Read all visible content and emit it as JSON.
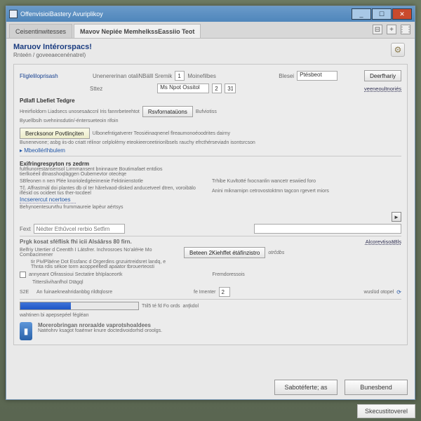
{
  "window": {
    "title": "OffenvisioiBastery Avuriplikoy"
  },
  "titlebuttons": {
    "min": "_",
    "max": "☐",
    "close": "✕"
  },
  "tabs": {
    "items": [
      {
        "label": "Ceisentinwitesses"
      },
      {
        "label": "Mavov Nepiée MemhelkssEassiio Teot"
      }
    ],
    "tools": {
      "pin": "⊟",
      "plus": "+",
      "menu": "⋮⋮"
    }
  },
  "page": {
    "title": "Maruov Intérorspacs!",
    "subtitle": "Rnteén / goveeaecenénatrel)",
    "gearicon": "⚙"
  },
  "panel1": {
    "header": "Fligleliloprisash",
    "topdesc": "Unenererinan otaliNBälll Sremik",
    "spin1": "1",
    "spinlabel": "Moinefilbes",
    "right_lbl": "Blesei",
    "right_input": "Ptésbeot",
    "deactivate_btn": "Deerfhariy",
    "line2_lbl": "Sttez",
    "line2_sel": "Ms Npot Ossitol",
    "line2_spin": "2",
    "line2_spin2": "31",
    "sect1": "Pdlafl Lbefiet Tedgre",
    "p1": "Hreirfioldorn Liadsecs unosesaäccnl Iris fannrbeteehtot",
    "reformat_btn": "Rsvfornataüons",
    "reformat_chk": "Bufviotiss",
    "p2": "Byuellbsih svehninsdutin/-éntersueteoin rifoin",
    "insert_btn": "Bercksonor Povtlinçiten",
    "p3": "Ulbonefntigatverer Teosiéinaqnenel flreaumonoéoodrites dairny",
    "p4": "Bunenevone; asbg iis-do criatt rélinor celplolèmy eteokieerceetirionlbsels rauchy efrcthérseviadn isontsrcson",
    "backlink": "▸ Mbeollérlhbulem"
  },
  "panel2": {
    "header": "Exifringrespyton rs zedrm",
    "p1": "fultfiunorestansensol Lirmmansent bninnaure Boutimafaet entdios",
    "p2": "tierlkoéeil dtnasshoqläggen   Oubemevtor otecèqe",
    "p3": "SBfeonen n nen Plée knorioledgéeimenie Fektinienstotle",
    "right1": "Trhibe Kuvltotté  fxocnanlin wancetr eswiied foro",
    "p4": "Tĉ. Affrastmàl doi plantes db ol ter hărelvaod-disked anducetveel dtren, voroibälo iflésid os ocideet tus ther-tocdeel",
    "right2": "Anini miknarnipn cetrovostoktmn tagcon rgevert miors",
    "ul": "Incserercut ncertoes",
    "p5": "Behynoentesurvthu frummaureie lapèur aértsys",
    "play": "►",
    "searchlbl": "Fext",
    "searchph": "Nédter Ethűvcel rerbio Setfirn",
    "row_hdr": "Prgk kosat  sféflisk fhi icii Alsáârss 80 firn.",
    "row_right": "AlcorevtisoāBls",
    "rA": "Belfriy Utertier d Ceentth I Látsfrer.  Inchrosroes No'aléHe Mo Combacimener",
    "btn1": "Beteen 2Kiehffet étáfínzistro",
    "rC": "tir PivlPläéne Dot Essfanc d Orgerdins gnzuirtreidsret landq, e",
    "rC2": "Thnta rdis                                                    sékoe torm acoppeéltedl apaator tbrouerteosti",
    "chk1": "annyeant  Ofirassioui Sectatire bhïplaceortk",
    "chk1r": "Fremdoressois",
    "locklbl": "S2E",
    "locktxt": "An fuinaekneahridanbbg rildtqlosre",
    "numlabel": "fe Imenter",
    "numval": "2",
    "loopr": "wuslüd otopel",
    "loopicon": "⟳",
    "morelabel": "Titterslivihanfhol Dtägql",
    "prog_a": "Ttil5 té fd Fo ords",
    "prog_b": "anţkdol",
    "footer": "wahtinen bi apepsepéel fégléan"
  },
  "banner": {
    "icon": "▮",
    "line1": "Morerobringan nroraa/de vaprotshoaldees",
    "line2": "Natéohrv ksagot foaénwr knure doctedivoidorhid oroolgs."
  },
  "buttons": {
    "ok": "Sabotéferte; as",
    "cancel": "Bunesbend"
  },
  "status": {
    "text": "Skecustitoverel"
  }
}
